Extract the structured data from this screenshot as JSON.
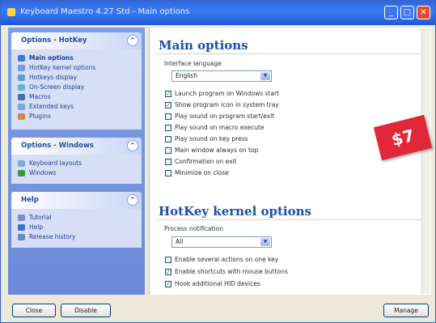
{
  "window": {
    "title": "Keyboard Maestro 4.27 Std - Main options"
  },
  "sidebar": {
    "panels": [
      {
        "title": "Options - HotKey",
        "items": [
          {
            "label": "Main options",
            "icon": "settings-icon",
            "color": "#3a7bd5",
            "active": true
          },
          {
            "label": "HotKey kernel options",
            "icon": "kernel-icon",
            "color": "#7a9ad8"
          },
          {
            "label": "Hotkeys display",
            "icon": "display-icon",
            "color": "#5aa0e0"
          },
          {
            "label": "On-Screen display",
            "icon": "osd-icon",
            "color": "#6cb0e4"
          },
          {
            "label": "Macros",
            "icon": "macros-icon",
            "color": "#4a6fb8"
          },
          {
            "label": "Extended keys",
            "icon": "keys-icon",
            "color": "#7fa3e0"
          },
          {
            "label": "Plugins",
            "icon": "plugins-icon",
            "color": "#d08a3c"
          }
        ]
      },
      {
        "title": "Options - Windows",
        "items": [
          {
            "label": "Keyboard layouts",
            "icon": "keyboard-icon",
            "color": "#8aa6d6"
          },
          {
            "label": "Windows",
            "icon": "windows-icon",
            "color": "#3a9a3a"
          }
        ]
      },
      {
        "title": "Help",
        "items": [
          {
            "label": "Tutorial",
            "icon": "tutorial-icon",
            "color": "#7a8fc0"
          },
          {
            "label": "Help",
            "icon": "help-icon",
            "color": "#3c6fd0"
          },
          {
            "label": "Release history",
            "icon": "history-icon",
            "color": "#6a8ac8"
          }
        ]
      }
    ]
  },
  "main_options": {
    "title": "Main options",
    "language_label": "Interface language",
    "language_value": "English",
    "checks": [
      {
        "label": "Launch program on Windows start",
        "checked": true
      },
      {
        "label": "Show program icon in system tray",
        "checked": true
      },
      {
        "label": "Play sound on program start/exit",
        "checked": false
      },
      {
        "label": "Play sound on macro execute",
        "checked": false
      },
      {
        "label": "Play sound on key press",
        "checked": false
      },
      {
        "label": "Main window always on top",
        "checked": false
      },
      {
        "label": "Confirmation on exit",
        "checked": false
      },
      {
        "label": "Minimize on close",
        "checked": false
      }
    ]
  },
  "kernel_options": {
    "title": "HotKey kernel options",
    "process_label": "Process notification",
    "process_value": "All",
    "checks": [
      {
        "label": "Enable several actions on one key",
        "checked": false
      },
      {
        "label": "Enable shortcuts with mouse buttons",
        "checked": true
      },
      {
        "label": "Hook additional HID devices",
        "checked": true
      }
    ]
  },
  "price_tag": "$7",
  "buttons": {
    "close": "Close",
    "disable": "Disable",
    "manage": "Manage"
  },
  "colors": {
    "accent": "#1e4ea6",
    "titlebar": "#2f66df",
    "price_tag": "#e0283a"
  }
}
